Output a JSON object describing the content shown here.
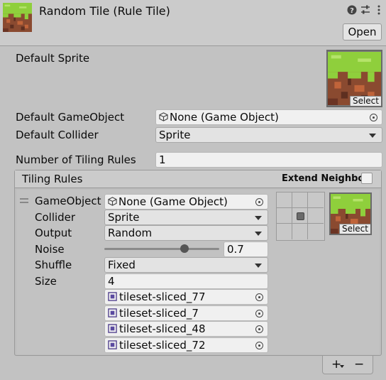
{
  "header": {
    "title": "Random Tile (Rule Tile)",
    "open_label": "Open",
    "icons": [
      "help-icon",
      "preset-sliders-icon",
      "more-menu-icon"
    ]
  },
  "default_sprite": {
    "label": "Default Sprite",
    "select_label": "Select"
  },
  "default_gameobject": {
    "label": "Default GameObject",
    "value": "None (Game Object)"
  },
  "default_collider": {
    "label": "Default Collider",
    "value": "Sprite"
  },
  "tiling_rules_count": {
    "label": "Number of Tiling Rules",
    "value": "1"
  },
  "tiling_rules": {
    "title": "Tiling Rules",
    "extend_neighbor_label": "Extend Neighbor",
    "extend_neighbor_checked": false,
    "rule": {
      "gameobject_label": "GameObject",
      "gameobject_value": "None (Game Object)",
      "collider_label": "Collider",
      "collider_value": "Sprite",
      "output_label": "Output",
      "output_value": "Random",
      "noise_label": "Noise",
      "noise_value": "0.7",
      "noise_fraction": 0.7,
      "shuffle_label": "Shuffle",
      "shuffle_value": "Fixed",
      "size_label": "Size",
      "size_value": "4",
      "sprites": [
        "tileset-sliced_77",
        "tileset-sliced_7",
        "tileset-sliced_48",
        "tileset-sliced_72"
      ],
      "preview_select_label": "Select"
    }
  },
  "footer": {
    "add_label": "+",
    "remove_label": "−"
  },
  "colors": {
    "grass": "#8bc34a",
    "dirt": "#a0522d",
    "panel": "#c2c2c2"
  }
}
